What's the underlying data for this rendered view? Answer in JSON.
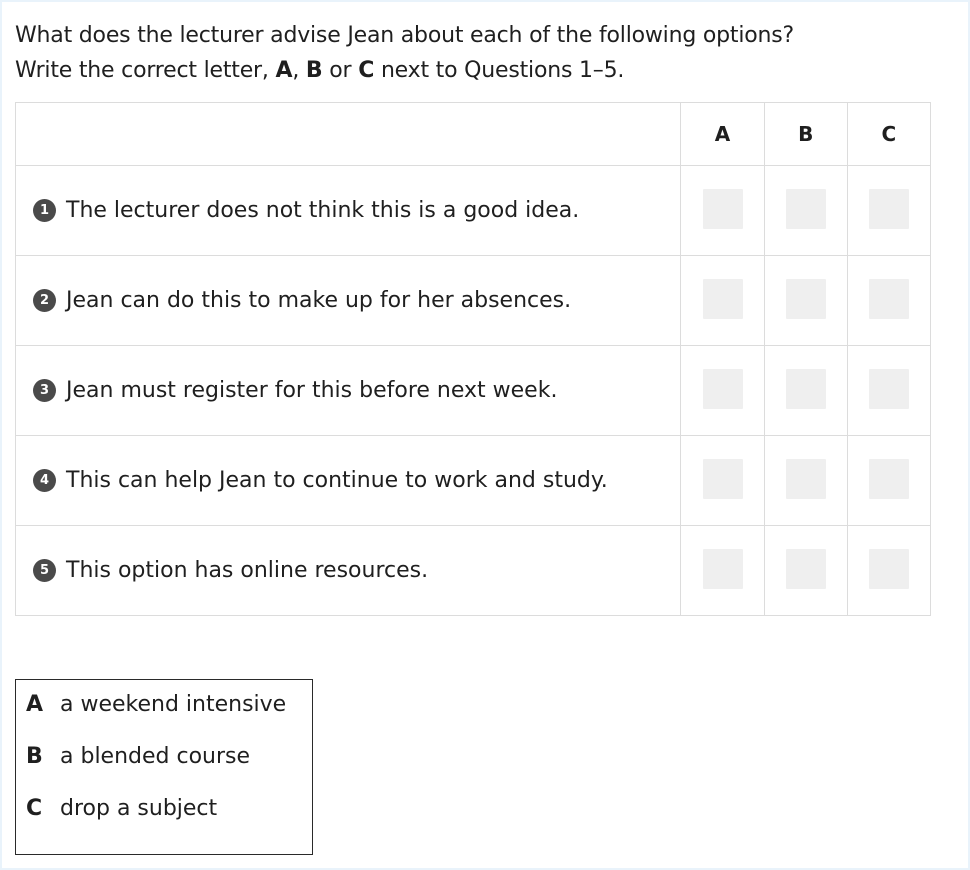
{
  "instructions": {
    "line1": "What does the lecturer advise Jean about each of the following options?",
    "line2_pre": "Write the correct letter,",
    "letter_a": "A",
    "sep1": ",",
    "letter_b": "B",
    "or_word": "or",
    "letter_c": "C",
    "line2_post": "next to Questions 1–5."
  },
  "table": {
    "headers": [
      "A",
      "B",
      "C"
    ],
    "questions": [
      {
        "number": "1",
        "text": "The lecturer does not think this is a good idea."
      },
      {
        "number": "2",
        "text": "Jean can do this to make up for her absences."
      },
      {
        "number": "3",
        "text": "Jean must register for this before next week."
      },
      {
        "number": "4",
        "text": "This can help Jean to continue to work and study."
      },
      {
        "number": "5",
        "text": "This option has online resources."
      }
    ]
  },
  "options": [
    {
      "letter": "A",
      "text": "a weekend intensive"
    },
    {
      "letter": "B",
      "text": "a blended course"
    },
    {
      "letter": "C",
      "text": "drop a subject"
    }
  ],
  "colors": {
    "background": "#e9f3fb",
    "badge": "#4a4a4a",
    "answer_box": "#efefef"
  }
}
